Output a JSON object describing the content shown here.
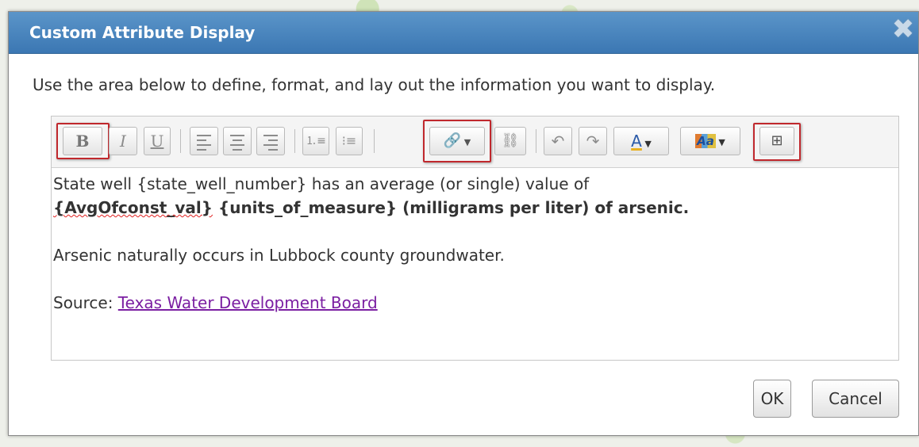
{
  "dialog": {
    "title": "Custom Attribute Display",
    "close_icon": "close-icon",
    "instructions": "Use the area below to define, format, and lay out the information you want to display."
  },
  "toolbar": {
    "bold": "B",
    "italic": "I",
    "underline": "U",
    "icons": [
      "bold-icon",
      "italic-icon",
      "underline-icon",
      "align-left-icon",
      "align-center-icon",
      "align-right-icon",
      "numbered-list-icon",
      "bullet-list-icon",
      "insert-link-icon",
      "unlink-icon",
      "undo-icon",
      "redo-icon",
      "font-color-icon",
      "text-style-icon",
      "insert-field-icon"
    ],
    "font_color_label": "A",
    "text_style_label": "Aa",
    "insert_field_label": "⊞"
  },
  "content": {
    "line1": "State well {state_well_number} has an average (or single) value of",
    "line2_field": "{AvgOfconst_val}",
    "line2_rest": " {units_of_measure} (milligrams per liter) of arsenic.",
    "para2": "Arsenic naturally occurs in Lubbock county groundwater.",
    "source_label": "Source: ",
    "source_link": "Texas Water Development Board"
  },
  "buttons": {
    "ok": "OK",
    "cancel": "Cancel"
  },
  "colors": {
    "title_bar": "#3b77b3",
    "highlight": "#c0282d",
    "link": "#7b1fa2"
  }
}
